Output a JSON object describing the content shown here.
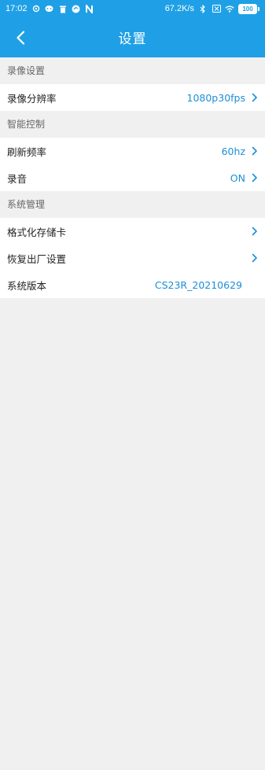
{
  "status_bar": {
    "time": "17:02",
    "network_speed": "67.2K/s",
    "battery": "100"
  },
  "app_bar": {
    "title": "设置"
  },
  "sections": [
    {
      "header": "录像设置",
      "rows": [
        {
          "label": "录像分辨率",
          "value": "1080p30fps",
          "chevron": true
        }
      ]
    },
    {
      "header": "智能控制",
      "rows": [
        {
          "label": "刷新频率",
          "value": "60hz",
          "chevron": true
        },
        {
          "label": "录音",
          "value": "ON",
          "chevron": true
        }
      ]
    },
    {
      "header": "系统管理",
      "rows": [
        {
          "label": "格式化存储卡",
          "value": "",
          "chevron": true
        },
        {
          "label": "恢复出厂设置",
          "value": "",
          "chevron": true
        },
        {
          "label": "系统版本",
          "value": "CS23R_20210629",
          "chevron": false
        }
      ]
    }
  ],
  "colors": {
    "accent": "#1fa0e6",
    "value_text": "#1c8fd6",
    "background": "#f0f0f0"
  }
}
